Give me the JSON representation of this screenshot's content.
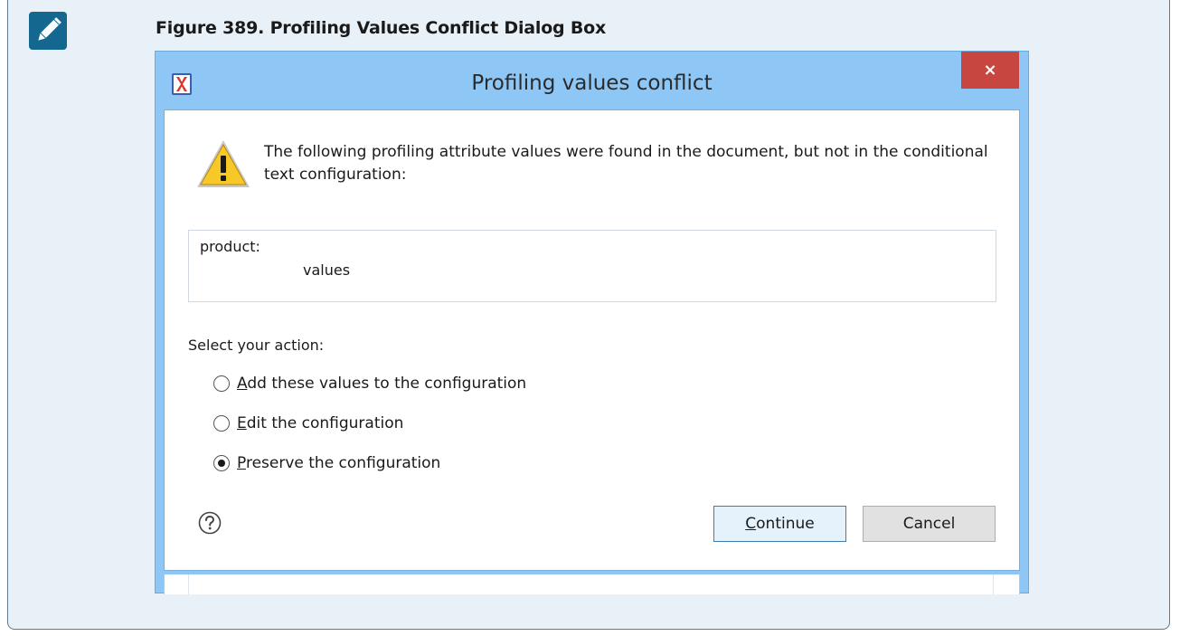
{
  "note": {
    "icon": "pencil-icon",
    "figure_title": "Figure 389. Profiling Values Conflict Dialog Box"
  },
  "dialog": {
    "title": "Profiling values conflict",
    "close_label": "×",
    "app_icon": "oxygen-x-icon",
    "warning_icon": "warning-icon",
    "message": "The following profiling attribute values were found in the document, but not in the conditional text configuration:",
    "values_box": {
      "attribute": "product:",
      "value": "values"
    },
    "select_label": "Select your action:",
    "options": [
      {
        "accel": "A",
        "rest": "dd these values to the configuration",
        "checked": false
      },
      {
        "accel": "E",
        "rest": "dit the configuration",
        "checked": false
      },
      {
        "accel": "P",
        "rest": "reserve the configuration",
        "checked": true
      }
    ],
    "help_icon": "help-icon",
    "continue": {
      "accel": "C",
      "rest": "ontinue"
    },
    "cancel_label": "Cancel"
  },
  "colors": {
    "note_background": "#e8f1f8",
    "note_icon": "#14688f",
    "dialog_frame": "#8ec6f5",
    "close_button": "#c7463f",
    "continue_button": "#e5f1fb"
  }
}
